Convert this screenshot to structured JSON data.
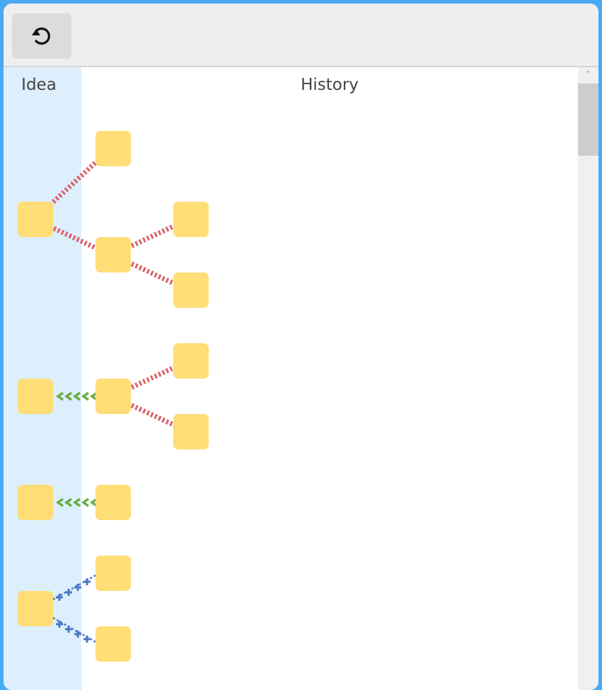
{
  "toolbar": {
    "reset_icon": "rotate-ccw-icon"
  },
  "columns": {
    "idea": "Idea",
    "history": "History"
  },
  "colors": {
    "node": "#ffdd77",
    "link_red": "#d9646a",
    "link_green": "#6aad45",
    "link_blue": "#4a78c4",
    "idea_column": "#ddeffd",
    "frame": "#48a9f5"
  }
}
